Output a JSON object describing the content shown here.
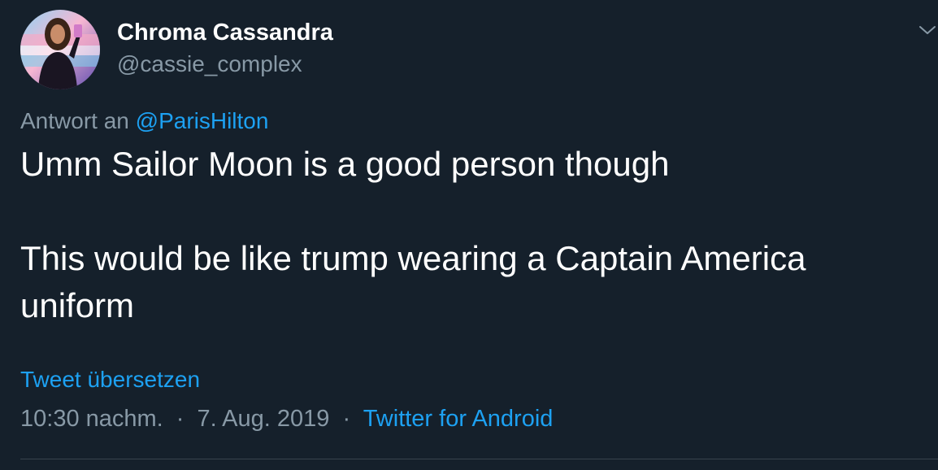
{
  "user": {
    "display_name": "Chroma Cassandra",
    "handle": "@cassie_complex",
    "avatar_icon": "profile-photo"
  },
  "menu": {
    "icon": "chevron-down-icon"
  },
  "reply": {
    "prefix": "Antwort an",
    "mention": "@ParisHilton"
  },
  "tweet": {
    "paragraphs": [
      "Umm Sailor Moon is a good person though",
      "This would be like trump wearing a Captain America uniform"
    ]
  },
  "translate_label": "Tweet übersetzen",
  "meta": {
    "time": "10:30 nachm.",
    "separator": "·",
    "date": "7. Aug. 2019",
    "source": "Twitter for Android"
  },
  "colors": {
    "background": "#15202b",
    "text_primary": "#ffffff",
    "text_secondary": "#8899a6",
    "accent": "#1da1f2",
    "divider": "#38444d"
  }
}
